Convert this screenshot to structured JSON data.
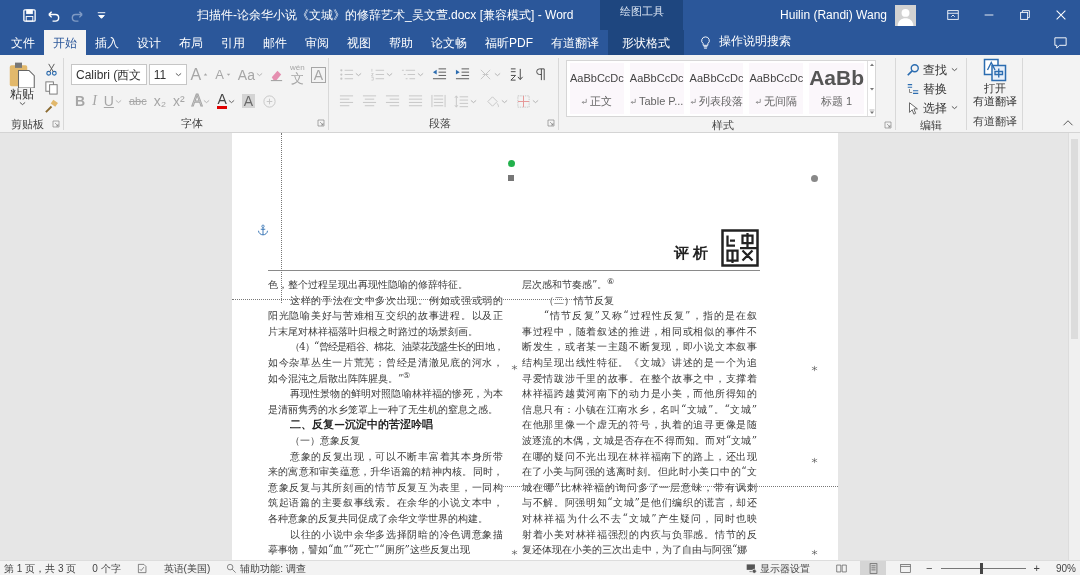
{
  "window": {
    "title": "扫描件-论余华小说《文城》的修辞艺术_吴文萱.docx [兼容模式] - Word",
    "context_label": "绘图工具",
    "user": "Huilin (Randi) Wang"
  },
  "quick_access": [
    {
      "kind": "save",
      "disabled": false
    },
    {
      "kind": "undo",
      "disabled": false
    },
    {
      "kind": "redo",
      "disabled": true
    },
    {
      "kind": "customize",
      "disabled": false
    }
  ],
  "tabs": [
    {
      "label": "文件",
      "selected": false,
      "contextual": false
    },
    {
      "label": "开始",
      "selected": true,
      "contextual": false
    },
    {
      "label": "插入",
      "selected": false,
      "contextual": false
    },
    {
      "label": "设计",
      "selected": false,
      "contextual": false
    },
    {
      "label": "布局",
      "selected": false,
      "contextual": false
    },
    {
      "label": "引用",
      "selected": false,
      "contextual": false
    },
    {
      "label": "邮件",
      "selected": false,
      "contextual": false
    },
    {
      "label": "审阅",
      "selected": false,
      "contextual": false
    },
    {
      "label": "视图",
      "selected": false,
      "contextual": false
    },
    {
      "label": "帮助",
      "selected": false,
      "contextual": false
    },
    {
      "label": "论文畅",
      "selected": false,
      "contextual": false
    },
    {
      "label": "福昕PDF",
      "selected": false,
      "contextual": false
    },
    {
      "label": "有道翻译",
      "selected": false,
      "contextual": false
    },
    {
      "label": "形状格式",
      "selected": false,
      "contextual": true
    }
  ],
  "tell_me": "操作说明搜索",
  "clipboard": {
    "label": "剪贴板",
    "paste": "粘贴"
  },
  "font": {
    "label": "字体",
    "font_name": "Calibri (西文",
    "font_size": "11",
    "row1": [
      {
        "kind": "grow",
        "text": "A",
        "disabled": true,
        "dropdown": false
      },
      {
        "kind": "shrink",
        "text": "A",
        "disabled": true,
        "dropdown": false
      },
      {
        "kind": "case",
        "text": "Aa",
        "disabled": true,
        "dropdown": true
      },
      {
        "kind": "eraser",
        "disabled": false,
        "dropdown": false
      },
      {
        "kind": "phonetic",
        "text": "文",
        "ruby": "wén",
        "disabled": true,
        "dropdown": false
      },
      {
        "kind": "char_border",
        "text": "A",
        "disabled": true,
        "dropdown": false
      }
    ],
    "row2": [
      {
        "kind": "bold",
        "text": "B",
        "disabled": true,
        "dropdown": false
      },
      {
        "kind": "italic",
        "text": "I",
        "disabled": true,
        "dropdown": false
      },
      {
        "kind": "underline",
        "text": "U",
        "disabled": true,
        "dropdown": true
      },
      {
        "kind": "strike",
        "text": "abc",
        "disabled": true,
        "dropdown": false
      },
      {
        "kind": "subscript",
        "text": "x₂",
        "disabled": true,
        "dropdown": false
      },
      {
        "kind": "superscript",
        "text": "x²",
        "disabled": true,
        "dropdown": false
      },
      {
        "kind": "effects",
        "text": "A",
        "disabled": true,
        "dropdown": true
      },
      {
        "kind": "font_color",
        "text": "A",
        "disabled": false,
        "dropdown": true
      },
      {
        "kind": "shaded",
        "text": "A",
        "disabled": true,
        "dropdown": false
      },
      {
        "kind": "enclose",
        "disabled": true,
        "dropdown": false
      }
    ]
  },
  "paragraph": {
    "label": "段落",
    "row1": [
      {
        "kind": "bullets",
        "disabled": true,
        "dropdown": true
      },
      {
        "kind": "numbering",
        "disabled": true,
        "dropdown": true
      },
      {
        "kind": "multilevel",
        "disabled": true,
        "dropdown": true
      },
      {
        "kind": "outdent",
        "disabled": false,
        "dropdown": false
      },
      {
        "kind": "indent",
        "disabled": false,
        "dropdown": false
      },
      {
        "kind": "asian",
        "disabled": true,
        "dropdown": true
      },
      {
        "kind": "sort",
        "disabled": false,
        "dropdown": false
      },
      {
        "kind": "marks",
        "disabled": false,
        "dropdown": false
      }
    ],
    "row2": [
      {
        "kind": "align_left",
        "disabled": true,
        "dropdown": false
      },
      {
        "kind": "center",
        "disabled": true,
        "dropdown": false
      },
      {
        "kind": "align_right",
        "disabled": true,
        "dropdown": false
      },
      {
        "kind": "justify",
        "disabled": true,
        "dropdown": false
      },
      {
        "kind": "distribute",
        "disabled": true,
        "dropdown": false
      },
      {
        "kind": "line_spacing",
        "disabled": true,
        "dropdown": true
      },
      {
        "kind": "shading",
        "disabled": true,
        "dropdown": true
      },
      {
        "kind": "borders",
        "disabled": true,
        "dropdown": true
      }
    ]
  },
  "styles": {
    "label": "样式",
    "items": [
      {
        "kind": "normal",
        "preview": "AaBbCcDc",
        "name": "正文",
        "paragraph_mark": true
      },
      {
        "kind": "normal",
        "preview": "AaBbCcDc",
        "name": "Table P...",
        "paragraph_mark": true
      },
      {
        "kind": "normal",
        "preview": "AaBbCcDc",
        "name": "列表段落",
        "paragraph_mark": true
      },
      {
        "kind": "normal",
        "preview": "AaBbCcDc",
        "name": "无间隔",
        "paragraph_mark": true
      },
      {
        "kind": "heading",
        "preview": "AaBb",
        "name": "标题 1",
        "paragraph_mark": false
      }
    ]
  },
  "editing": {
    "label": "编辑",
    "items": [
      {
        "kind": "find",
        "label": "查找",
        "dropdown": true
      },
      {
        "kind": "replace",
        "label": "替换",
        "dropdown": false
      },
      {
        "kind": "select",
        "label": "选择",
        "dropdown": true
      }
    ]
  },
  "translate": {
    "label": "有道翻译",
    "button_lines": [
      "打开",
      "有道翻译"
    ]
  },
  "document": {
    "header": "评析",
    "columns": [
      {
        "paragraphs": [
          {
            "kind": "continuation",
            "lines": [
              "色，整个过程呈现出再现性隐喻的修辞特征。"
            ]
          },
          {
            "kind": "body",
            "lines": [
              "这样的手法在文中多次出现。例如或强或弱的",
              "阳光隐喻美好与苦难相互交织的故事进程。以及正",
              "片末尾对林祥福落叶归根之时路过的场景刻画。"
            ]
          },
          {
            "kind": "body",
            "lines": [
              "（4）“曾经是稻谷、棉花、油菜花茂盛生长的田地，",
              "如今杂草丛生一片荒芜；曾经是清澈见底的河水，",
              "如今混沌之后散出阵阵腥臭。”$^{⑤}$"
            ]
          },
          {
            "kind": "body",
            "lines": [
              "再现性景物的鲜明对照隐喻林祥福的惨死，为本",
              "是清丽隽秀的水乡笼罩上一种了无生机的窒息之感。"
            ]
          },
          {
            "kind": "heading",
            "lines": [
              "二、反复—沉淀中的苦涩吟唱"
            ]
          },
          {
            "kind": "subheading",
            "lines": [
              "（一）意象反复"
            ]
          },
          {
            "kind": "body",
            "lines": [
              "意象的反复出现，可以不断丰富着其本身所带",
              "来的寓意和审美蕴意，升华语篇的精神内核。同时，",
              "意象反复与其所刻画的情节反复互为表里，一同构",
              "筑起语篇的主要叙事线索。在余华的小说文本中，",
              "各种意象的反复共同促成了余华文学世界的构建。"
            ]
          },
          {
            "kind": "body",
            "lines": [
              "以往的小说中余华多选择阴暗的冷色调意象描",
              "摹事物，譬如“血”“死亡”“厕所”这些反复出现"
            ]
          }
        ]
      },
      {
        "paragraphs": [
          {
            "kind": "continuation",
            "lines": [
              "层次感和节奏感”。$^{⑥}$"
            ]
          },
          {
            "kind": "subheading",
            "lines": [
              "（二）情节反复"
            ]
          },
          {
            "kind": "body",
            "lines": [
              "“情节反复”又称“过程性反复”，指的是在叙",
              "事过程中，随着叙述的推进，相同或相似的事件不",
              "断发生，或者某一主题不断复现，即小说文本叙事",
              "结构呈现出线性特征。《文城》讲述的是一个为追",
              "寻爱情跋涉千里的故事。在整个故事之中，支撑着",
              "林祥福跨越黄河南下的动力是小美，而他所得知的",
              "信息只有：小镇在江南水乡，名叫“文城”。“文城”",
              "在他那里像一个虚无的符号，执着的追寻更像是随",
              "波逐流的木偶，文城是否存在不得而知。而对“文城”",
              "在哪的疑问不光出现在林祥福南下的路上，还出现",
              "在了小美与阿强的逃离时刻。但此时小美口中的“文",
              "城在哪”比林祥福的询问多了一层意味，带有讽刺",
              "与不解。阿强明知“文城”是他们编织的谎言，却还",
              "对林祥福为什么不去“文城”产生疑问，同时也映",
              "射着小美对林祥福强烈的内疚与负罪感。情节的反",
              "复还体现在小美的三次出走中，为了自由与阿强“娜"
            ]
          }
        ]
      }
    ]
  },
  "status_bar": {
    "page": "第 1 页，共 3 页",
    "words": "0 个字",
    "language": "英语(美国)",
    "accessibility": "辅助功能: 调查",
    "display_settings": "显示器设置",
    "views": [
      {
        "kind": "read",
        "selected": false
      },
      {
        "kind": "print",
        "selected": true
      },
      {
        "kind": "web",
        "selected": false
      }
    ],
    "zoom_out": "−",
    "zoom_in": "+",
    "zoom": {
      "level": 0.48
    },
    "zoom_percent": "90%"
  }
}
